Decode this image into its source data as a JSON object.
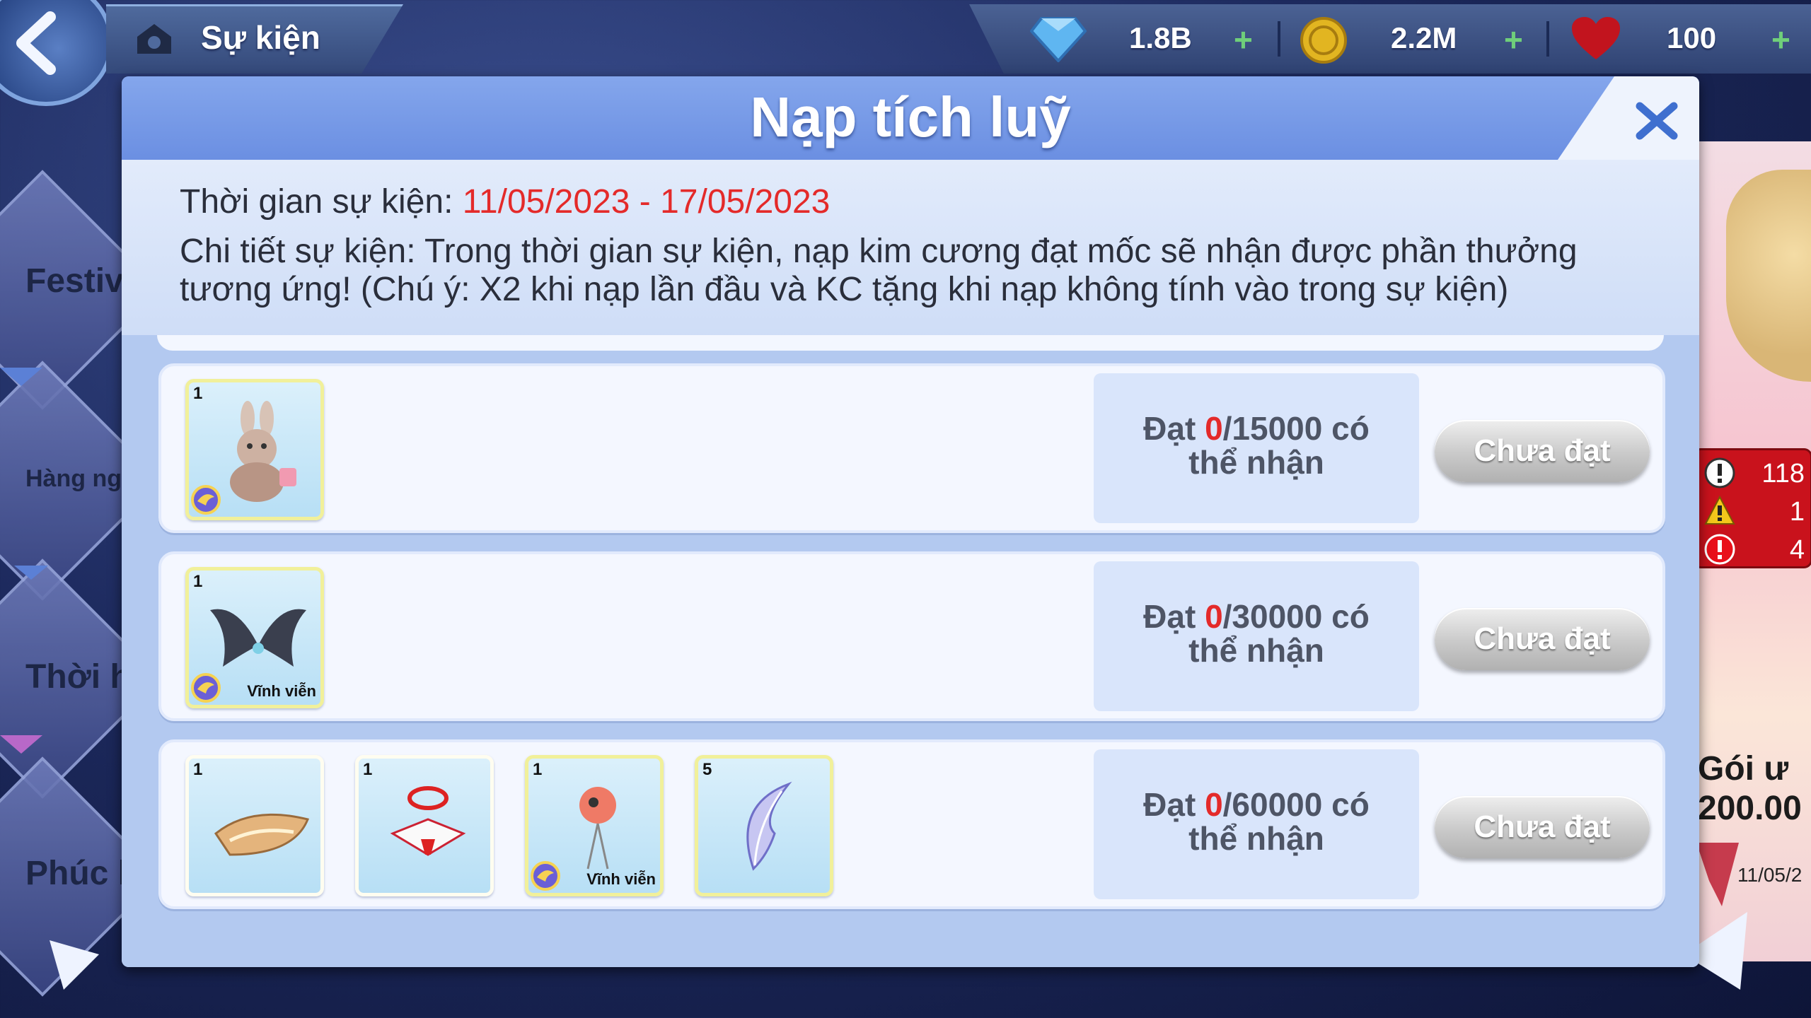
{
  "topbar": {
    "title": "Sự kiện",
    "diamonds": "1.8B",
    "coins": "2.2M",
    "hearts": "100"
  },
  "sidebar": {
    "items": [
      {
        "label": "Festiv"
      },
      {
        "label": "Hàng ng"
      },
      {
        "label": "Thời hạ"
      },
      {
        "label": "Phúc l"
      }
    ]
  },
  "alerts": {
    "info_count": "118",
    "warning_count": "1",
    "error_count": "4"
  },
  "right_panel": {
    "pack_line1": "Gói ư",
    "pack_line2": "200.00",
    "date": "11/05/2"
  },
  "modal": {
    "title": "Nạp tích luỹ",
    "event_time_label": "Thời gian sự kiện: ",
    "event_time_value": "11/05/2023 - 17/05/2023",
    "details_line1": "Chi tiết sự kiện: Trong thời gian sự kiện, nạp kim cương đạt mốc sẽ nhận được phần thưởng",
    "details_line2": "tương ứng! (Chú ý: X2 khi nạp lần đầu và KC tặng khi nạp không tính vào trong sự kiện)"
  },
  "rewards": [
    {
      "progress": "0",
      "target": "/15000 có",
      "prefix": "Đạt ",
      "suffix": "thể nhận",
      "status": "Chưa đạt",
      "items": [
        {
          "qty": "1",
          "name": "bunny-plush-icon",
          "perm": ""
        }
      ]
    },
    {
      "progress": "0",
      "target": "/30000 có",
      "prefix": "Đạt ",
      "suffix": "thể nhận",
      "status": "Chưa đạt",
      "items": [
        {
          "qty": "1",
          "name": "dark-wings-icon",
          "perm": "Vĩnh viễn"
        }
      ]
    },
    {
      "progress": "0",
      "target": "/60000 có",
      "prefix": "Đạt ",
      "suffix": "thể nhận",
      "status": "Chưa đạt",
      "items": [
        {
          "qty": "1",
          "name": "golden-bundle-icon",
          "perm": ""
        },
        {
          "qty": "1",
          "name": "gift-box-icon",
          "perm": ""
        },
        {
          "qty": "1",
          "name": "bird-balloon-icon",
          "perm": "Vĩnh viễn"
        },
        {
          "qty": "5",
          "name": "feather-icon",
          "perm": ""
        }
      ]
    }
  ],
  "colors": {
    "accent_red": "#e42a2a",
    "header_blue": "#7b9de8",
    "button_grey": "#c9c9c9"
  }
}
